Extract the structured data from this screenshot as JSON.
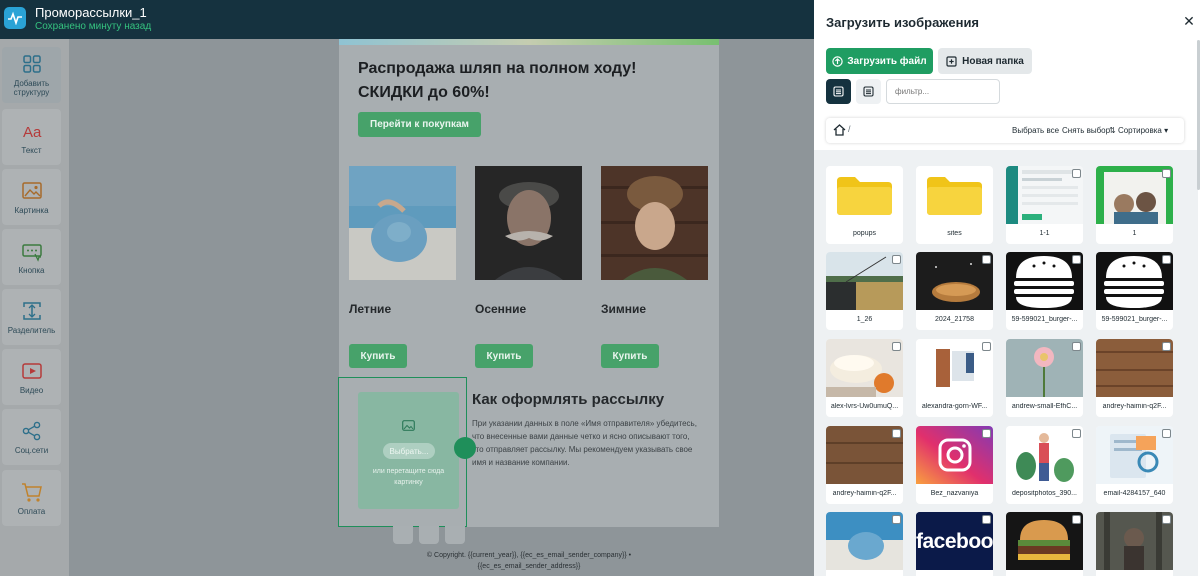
{
  "app": {
    "title": "Проморассылки_1",
    "saved_status": "Сохранено минуту назад"
  },
  "toolbar": {
    "items": [
      {
        "label": "Добавить\nструктуру",
        "icon": "grid-icon",
        "active": true
      },
      {
        "label": "Текст",
        "icon": "text-icon"
      },
      {
        "label": "Картинка",
        "icon": "image-icon"
      },
      {
        "label": "Кнопка",
        "icon": "button-icon"
      },
      {
        "label": "Разделитель",
        "icon": "divider-icon"
      },
      {
        "label": "Видео",
        "icon": "video-icon"
      },
      {
        "label": "Соц.сети",
        "icon": "share-icon"
      },
      {
        "label": "Оплата",
        "icon": "cart-icon"
      }
    ]
  },
  "email": {
    "headline_line1": "Распродажа шляп на полном ходу!",
    "headline_line2": "СКИДКИ до 60%!",
    "cta_label": "Перейти к покупкам",
    "products": [
      {
        "name": "Летние",
        "buy_label": "Купить"
      },
      {
        "name": "Осенние",
        "buy_label": "Купить"
      },
      {
        "name": "Зимние",
        "buy_label": "Купить"
      }
    ],
    "section_title": "Как оформлять рассылку",
    "section_text": "При указании данных в поле «Имя отправителя» убедитесь, что внесенные вами данные четко и ясно описывают того, кто отправляет рассылку. Мы рекомендуем указывать свое имя и название компании.",
    "dropzone_button": "Выбрать...",
    "dropzone_hint": "или перетащите сюда картинку",
    "footer_line1": "© Copyright. {{current_year}}, {{ec_es_email_sender_company}} •",
    "footer_line2": "{{ec_es_email_sender_address}}"
  },
  "panel": {
    "title": "Загрузить изображения",
    "upload_label": "Загрузить файл",
    "new_folder_label": "Новая папка",
    "filter_placeholder": "фильтр...",
    "path_separator": "/",
    "select_all": "Выбрать все",
    "deselect": "Снять выбор",
    "sort_label": "Сортировка",
    "files": [
      {
        "name": "popups",
        "type": "folder"
      },
      {
        "name": "sites",
        "type": "folder"
      },
      {
        "name": "1-1",
        "type": "screenshot"
      },
      {
        "name": "1",
        "type": "photo-green"
      },
      {
        "name": "1_26",
        "type": "photo-lake"
      },
      {
        "name": "2024_21758",
        "type": "photo-bread"
      },
      {
        "name": "59-599021_burger-...",
        "type": "burger"
      },
      {
        "name": "59-599021_burger-...",
        "type": "burger"
      },
      {
        "name": "alex-lvrs-Uw0umuQ...",
        "type": "photo-cake"
      },
      {
        "name": "alexandra-gorn-WF...",
        "type": "photo-room"
      },
      {
        "name": "andrew-small-EfhC...",
        "type": "photo-flower"
      },
      {
        "name": "andrey-haimin-q2F...",
        "type": "photo-wood"
      },
      {
        "name": "andrey-haimin-q2F...",
        "type": "photo-wood2"
      },
      {
        "name": "Bez_nazvaniya",
        "type": "instagram"
      },
      {
        "name": "depositphotos_390...",
        "type": "illustration"
      },
      {
        "name": "email-4284157_640",
        "type": "email-illustration"
      },
      {
        "name": "",
        "type": "photo-beach"
      },
      {
        "name": "",
        "type": "facebook"
      },
      {
        "name": "",
        "type": "photo-burger"
      },
      {
        "name": "",
        "type": "photo-forest"
      }
    ],
    "facebook_text": "faceboo"
  },
  "colors": {
    "accent_green": "#1f9d62",
    "topbar": "#15323f",
    "saved_green": "#35c27f"
  }
}
